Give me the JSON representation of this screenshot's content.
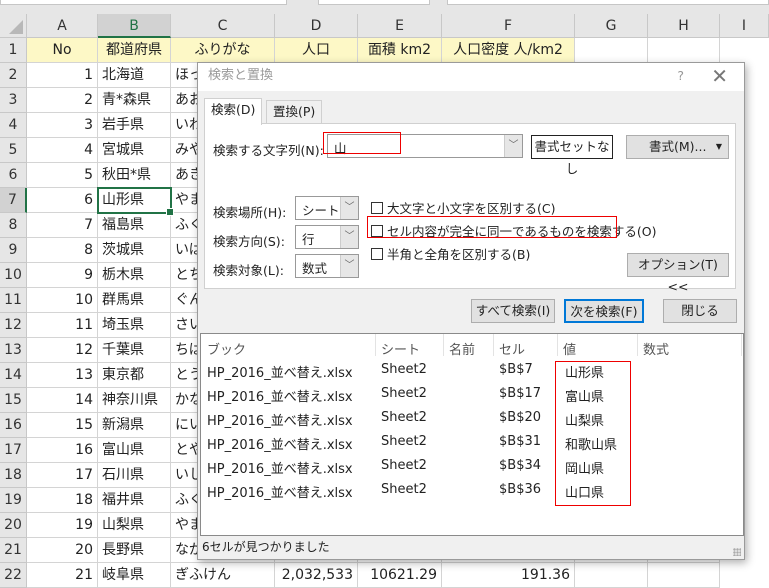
{
  "columns": [
    "A",
    "B",
    "C",
    "D",
    "E",
    "F",
    "G",
    "H",
    "I"
  ],
  "header_row": [
    "No",
    "都道府県",
    "ふりがな",
    "人口",
    "面積 km2",
    "人口密度 人/km2"
  ],
  "rows": [
    [
      "1",
      "北海道",
      "ほっ",
      "",
      "",
      ""
    ],
    [
      "2",
      "青*森県",
      "あお",
      "",
      "",
      ""
    ],
    [
      "3",
      "岩手県",
      "いわ",
      "",
      "",
      ""
    ],
    [
      "4",
      "宮城県",
      "みや",
      "",
      "",
      ""
    ],
    [
      "5",
      "秋田*県",
      "あき",
      "",
      "",
      ""
    ],
    [
      "6",
      "山形県",
      "やま",
      "",
      "",
      ""
    ],
    [
      "7",
      "福島県",
      "ふく",
      "",
      "",
      ""
    ],
    [
      "8",
      "茨城県",
      "いば",
      "",
      "",
      ""
    ],
    [
      "9",
      "栃木県",
      "とち",
      "",
      "",
      ""
    ],
    [
      "10",
      "群馬県",
      "ぐん",
      "",
      "",
      ""
    ],
    [
      "11",
      "埼玉県",
      "さい",
      "",
      "",
      ""
    ],
    [
      "12",
      "千葉県",
      "ちば",
      "",
      "",
      ""
    ],
    [
      "13",
      "東京都",
      "とう",
      "",
      "",
      ""
    ],
    [
      "14",
      "神奈川県",
      "かな",
      "",
      "",
      ""
    ],
    [
      "15",
      "新潟県",
      "にい",
      "",
      "",
      ""
    ],
    [
      "16",
      "富山県",
      "とや",
      "",
      "",
      ""
    ],
    [
      "17",
      "石川県",
      "いし",
      "",
      "",
      ""
    ],
    [
      "18",
      "福井県",
      "ふく",
      "",
      "",
      ""
    ],
    [
      "19",
      "山梨県",
      "やま",
      "",
      "",
      ""
    ],
    [
      "20",
      "長野県",
      "なが",
      "",
      "",
      ""
    ],
    [
      "21",
      "岐阜県",
      "ぎふけん",
      "2,032,533",
      "10621.29",
      "191.36"
    ]
  ],
  "dialog": {
    "title": "検索と置換",
    "help": "?",
    "close": "✕",
    "tabs": [
      "検索(D)",
      "置換(P)"
    ],
    "find_label": "検索する文字列(N):",
    "find_value": "山",
    "no_format": "書式セットなし",
    "format_btn": "書式(M)...",
    "within_label": "検索場所(H):",
    "within_value": "シート",
    "search_label": "検索方向(S):",
    "search_value": "行",
    "lookin_label": "検索対象(L):",
    "lookin_value": "数式",
    "opt_case": "大文字と小文字を区別する(C)",
    "opt_whole": "セル内容が完全に同一であるものを検索する(O)",
    "opt_width": "半角と全角を区別する(B)",
    "options_btn": "オプション(T) <<",
    "find_all": "すべて検索(I)",
    "find_next": "次を検索(F)",
    "close_btn": "閉じる",
    "list_headers": [
      "ブック",
      "シート",
      "名前",
      "セル",
      "値",
      "数式"
    ],
    "results": [
      [
        "HP_2016_並べ替え.xlsx",
        "Sheet2",
        "",
        "$B$7",
        "山形県",
        ""
      ],
      [
        "HP_2016_並べ替え.xlsx",
        "Sheet2",
        "",
        "$B$17",
        "富山県",
        ""
      ],
      [
        "HP_2016_並べ替え.xlsx",
        "Sheet2",
        "",
        "$B$20",
        "山梨県",
        ""
      ],
      [
        "HP_2016_並べ替え.xlsx",
        "Sheet2",
        "",
        "$B$31",
        "和歌山県",
        ""
      ],
      [
        "HP_2016_並べ替え.xlsx",
        "Sheet2",
        "",
        "$B$34",
        "岡山県",
        ""
      ],
      [
        "HP_2016_並べ替え.xlsx",
        "Sheet2",
        "",
        "$B$36",
        "山口県",
        ""
      ]
    ],
    "status": "6セルが見つかりました"
  },
  "colors": {
    "accent": "#217346",
    "highlight": "#e00000",
    "header_fill": "#fdf8c6"
  }
}
